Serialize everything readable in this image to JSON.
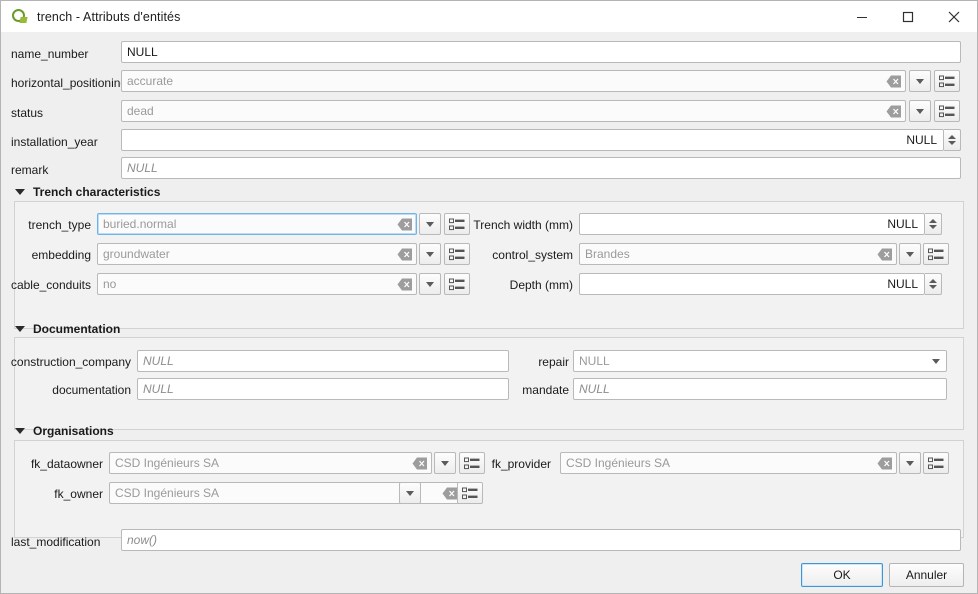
{
  "window": {
    "title": "trench - Attributs d'entités",
    "app_icon": "qgis-logo-icon",
    "controls": {
      "minimize": "minimize-icon",
      "maximize": "maximize-icon",
      "close": "close-icon"
    }
  },
  "top_fields": [
    {
      "label": "name_number",
      "value": "NULL",
      "style": "plain"
    },
    {
      "label": "horizontal_positioning",
      "value": "accurate",
      "style": "grey"
    },
    {
      "label": "status",
      "value": "dead",
      "style": "grey"
    },
    {
      "label": "installation_year",
      "value": "NULL",
      "style": "number"
    },
    {
      "label": "remark",
      "value": "NULL",
      "style": "italic"
    }
  ],
  "sections": {
    "trench": {
      "title": "Trench characteristics",
      "left": [
        {
          "label": "trench_type",
          "value": "buried.normal"
        },
        {
          "label": "embedding",
          "value": "groundwater"
        },
        {
          "label": "cable_conduits",
          "value": "no"
        }
      ],
      "right": [
        {
          "label": "Trench width (mm)",
          "value": "NULL"
        },
        {
          "label": "control_system",
          "value": "Brandes"
        },
        {
          "label": "Depth (mm)",
          "value": "NULL"
        }
      ]
    },
    "documentation": {
      "title": "Documentation",
      "left": [
        {
          "label": "construction_company",
          "value": "NULL"
        },
        {
          "label": "documentation",
          "value": "NULL"
        }
      ],
      "right": [
        {
          "label": "repair",
          "value": "NULL"
        },
        {
          "label": "mandate",
          "value": "NULL"
        }
      ]
    },
    "organisations": {
      "title": "Organisations",
      "left": [
        {
          "label": "fk_dataowner",
          "value": "CSD Ingénieurs SA"
        },
        {
          "label": "fk_owner",
          "value": "CSD Ingénieurs SA"
        }
      ],
      "right": [
        {
          "label": "fk_provider",
          "value": "CSD Ingénieurs SA"
        }
      ]
    }
  },
  "last_modification": {
    "label": "last_modification",
    "value": "now()"
  },
  "buttons": {
    "ok": "OK",
    "cancel": "Annuler"
  },
  "icons": {
    "clear": "clear-value-icon",
    "dropdown": "chevron-down-icon",
    "open_form": "open-form-icon",
    "spinner": "spinner-arrows-icon"
  },
  "colors": {
    "focus": "#6fb4e8",
    "accent": "#3d97d6",
    "background": "#efefef"
  }
}
